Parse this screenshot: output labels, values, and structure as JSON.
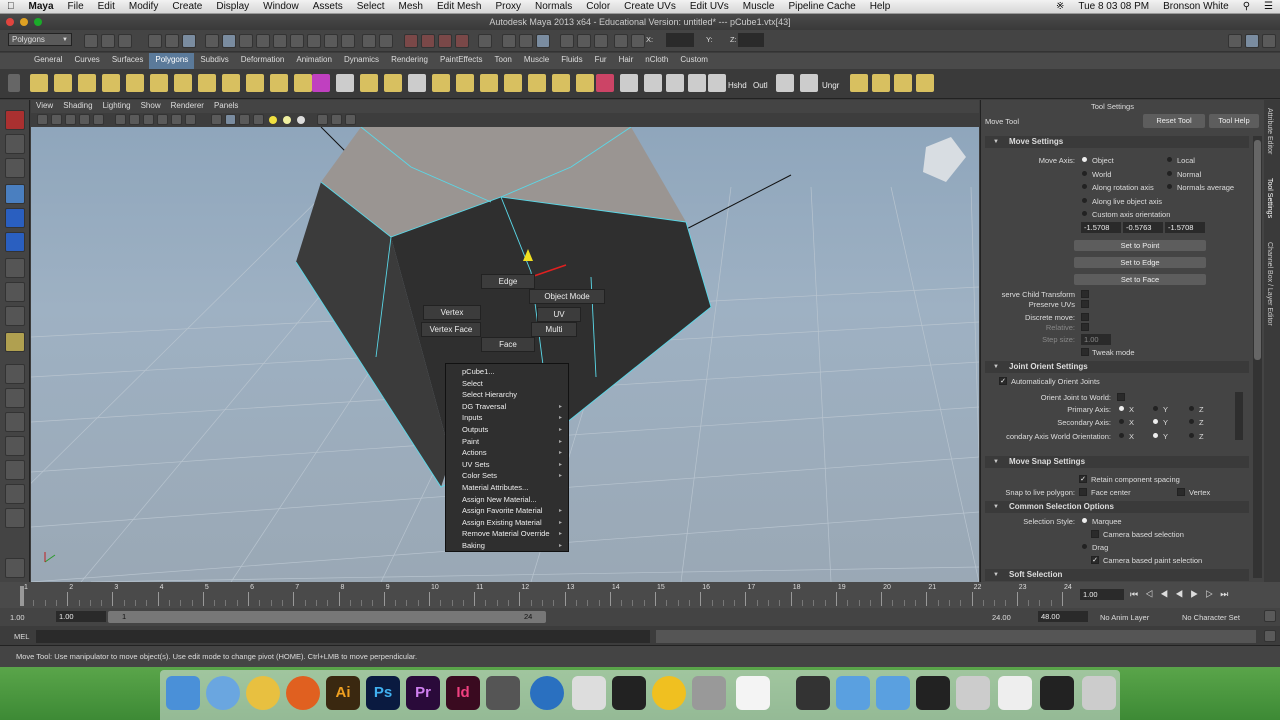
{
  "mac_menu": {
    "app": "Maya",
    "items": [
      "File",
      "Edit",
      "Modify",
      "Create",
      "Display",
      "Window",
      "Assets",
      "Select",
      "Mesh",
      "Edit Mesh",
      "Proxy",
      "Normals",
      "Color",
      "Create UVs",
      "Edit UVs",
      "Muscle",
      "Pipeline Cache",
      "Help"
    ],
    "clock": "Tue 8 03 08 PM",
    "user": "Bronson White"
  },
  "window_title": "Autodesk Maya 2013 x64 - Educational Version: untitled*   ---   pCube1.vtx[43]",
  "status_line": {
    "menu_set": "Polygons",
    "x_label": "X:",
    "y_label": "Y:",
    "z_label": "Z:"
  },
  "shelf_tabs": [
    "General",
    "Curves",
    "Surfaces",
    "Polygons",
    "Subdivs",
    "Deformation",
    "Animation",
    "Dynamics",
    "Rendering",
    "PaintEffects",
    "Toon",
    "Muscle",
    "Fluids",
    "Fur",
    "Hair",
    "nCloth",
    "Custom"
  ],
  "shelf_active": "Polygons",
  "shelf_labels": {
    "hshd": "Hshd",
    "outl": "Outl",
    "ungr": "Ungr"
  },
  "panel_menu": [
    "View",
    "Shading",
    "Lighting",
    "Show",
    "Renderer",
    "Panels"
  ],
  "marking_menu": {
    "edge": "Edge",
    "object_mode": "Object Mode",
    "vertex": "Vertex",
    "uv": "UV",
    "vertex_face": "Vertex Face",
    "multi": "Multi",
    "face": "Face"
  },
  "context_menu": [
    {
      "label": "pCube1...",
      "sub": false
    },
    {
      "label": "Select",
      "sub": false
    },
    {
      "label": "Select Hierarchy",
      "sub": false
    },
    {
      "label": "DG Traversal",
      "sub": true
    },
    {
      "label": "Inputs",
      "sub": true
    },
    {
      "label": "Outputs",
      "sub": true
    },
    {
      "label": "Paint",
      "sub": true
    },
    {
      "label": "Actions",
      "sub": true
    },
    {
      "label": "UV Sets",
      "sub": true
    },
    {
      "label": "Color Sets",
      "sub": true
    },
    {
      "label": "Material Attributes...",
      "sub": false
    },
    {
      "label": "Assign New Material...",
      "sub": false
    },
    {
      "label": "Assign Favorite Material",
      "sub": true
    },
    {
      "label": "Assign Existing Material",
      "sub": true
    },
    {
      "label": "Remove Material Override",
      "sub": true
    },
    {
      "label": "Baking",
      "sub": true
    }
  ],
  "tool_settings": {
    "title": "Tool Settings",
    "tool": "Move Tool",
    "reset": "Reset Tool",
    "help": "Tool Help",
    "move_settings": "Move Settings",
    "move_axis": "Move Axis:",
    "axis_left": [
      "Object",
      "World",
      "Along rotation axis",
      "Along live object axis",
      "Custom axis orientation"
    ],
    "axis_right": [
      "Local",
      "Normal",
      "Normals average"
    ],
    "values": [
      "-1.5708",
      "-0.5763",
      "-1.5708"
    ],
    "set_point": "Set to Point",
    "set_edge": "Set to Edge",
    "set_face": "Set to Face",
    "preserve_child": "serve Child Transform",
    "preserve_uvs": "Preserve UVs",
    "discrete": "Discrete move:",
    "relative": "Relative:",
    "step_size": "Step size:",
    "step_val": "1.00",
    "tweak": "Tweak mode",
    "joint_orient": "Joint Orient Settings",
    "auto_orient": "Automatically Orient Joints",
    "orient_world": "Orient Joint to World:",
    "primary": "Primary Axis:",
    "secondary": "Secondary Axis:",
    "sec_world": "condary Axis World Orientation:",
    "x": "X",
    "y": "Y",
    "z": "Z",
    "snap": "Move Snap Settings",
    "retain": "Retain component spacing",
    "snap_live": "Snap to live polygon:",
    "face_center": "Face center",
    "vertex": "Vertex",
    "common": "Common Selection Options",
    "sel_style": "Selection Style:",
    "marquee": "Marquee",
    "cam_sel": "Camera based selection",
    "drag": "Drag",
    "cam_paint": "Camera based paint selection",
    "soft": "Soft Selection"
  },
  "side_tabs": [
    "Attribute Editor",
    "Tool Settings",
    "Channel Box / Layer Editor"
  ],
  "time_ticks": [
    "1",
    "2",
    "3",
    "4",
    "5",
    "6",
    "7",
    "8",
    "9",
    "10",
    "11",
    "12",
    "13",
    "14",
    "15",
    "16",
    "17",
    "18",
    "19",
    "20",
    "21",
    "22",
    "23",
    "24"
  ],
  "current_frame": "1.00",
  "range": {
    "start": "1.00",
    "start2": "1.00",
    "handle_start": "1",
    "handle_end": "24",
    "end": "24.00",
    "end2": "48.00",
    "anim_layer": "No Anim Layer",
    "char_set": "No Character Set"
  },
  "cmd_label": "MEL",
  "help_text": "Move Tool: Use manipulator to move object(s). Use edit mode to change pivot (HOME). Ctrl+LMB to move perpendicular.",
  "dock_labels": {
    "ai": "Ai",
    "ps": "Ps",
    "pr": "Pr",
    "id": "Id"
  }
}
